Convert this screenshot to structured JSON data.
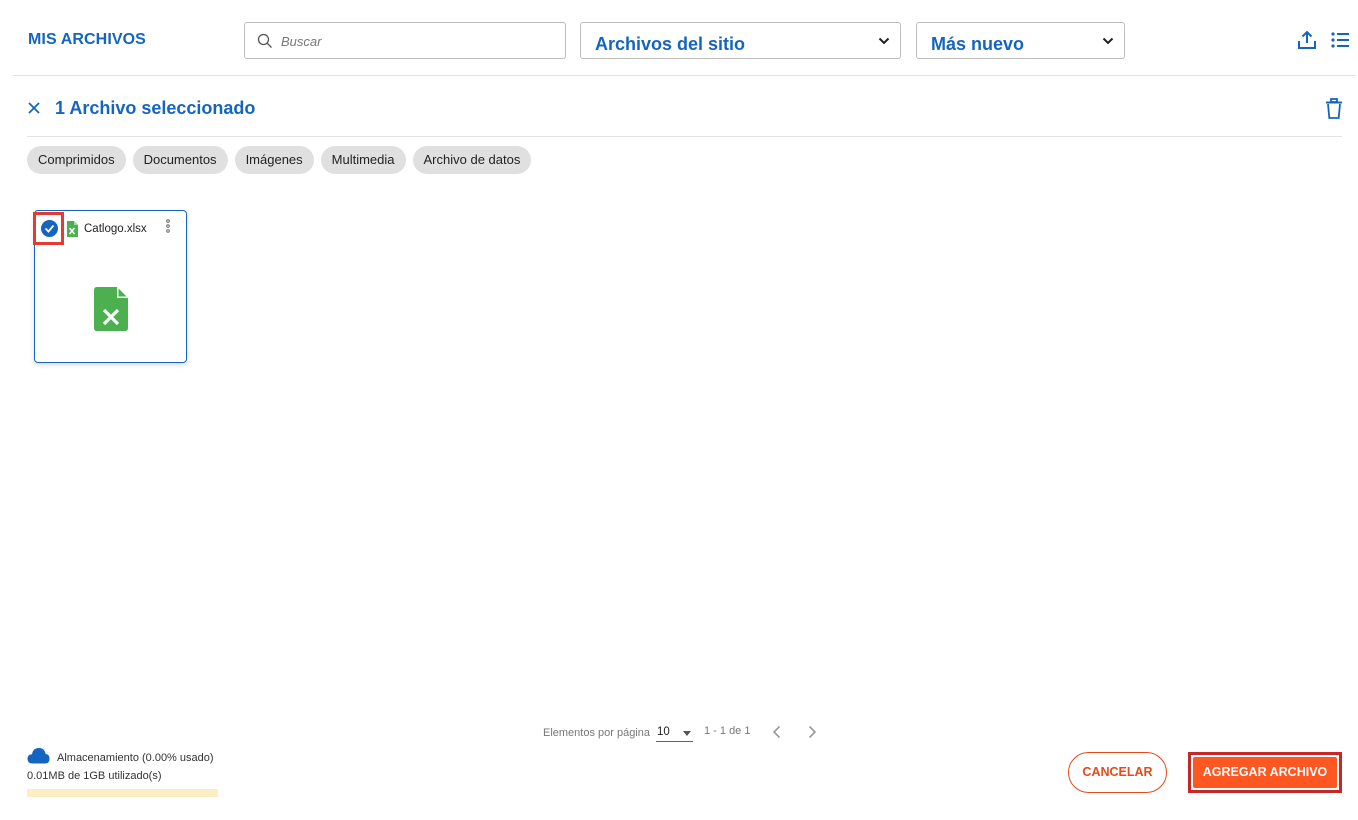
{
  "header": {
    "title": "MIS ARCHIVOS",
    "search": {
      "placeholder": "Buscar",
      "value": ""
    },
    "source_select": {
      "selected": "Archivos del sitio"
    },
    "order_select": {
      "selected": "Más nuevo"
    },
    "icons": {
      "upload": "upload-icon",
      "list_view": "list-view-icon"
    }
  },
  "selection_bar": {
    "text": "1 Archivo seleccionado",
    "close_icon": "close-icon",
    "delete_icon": "trash-icon"
  },
  "filter_chips": [
    {
      "label": "Comprimidos"
    },
    {
      "label": "Documentos"
    },
    {
      "label": "Imágenes"
    },
    {
      "label": "Multimedia"
    },
    {
      "label": "Archivo de datos"
    }
  ],
  "files": [
    {
      "name": "Catlogo.xlsx",
      "selected": true,
      "icon": "excel-file-icon"
    }
  ],
  "pagination": {
    "label": "Elementos por página",
    "page_size": "10",
    "range": "1 - 1 de 1"
  },
  "storage": {
    "label": "Almacenamiento (0.00% usado)",
    "used": "0.01MB de 1GB utilizado(s)",
    "used_fraction": 0.0
  },
  "footer": {
    "cancel_label": "CANCELAR",
    "add_label": "AGREGAR ARCHIVO"
  },
  "colors": {
    "primary": "#1565c0",
    "accent": "#ff5722",
    "excel_green": "#4caf50",
    "highlight": "#e53935"
  }
}
